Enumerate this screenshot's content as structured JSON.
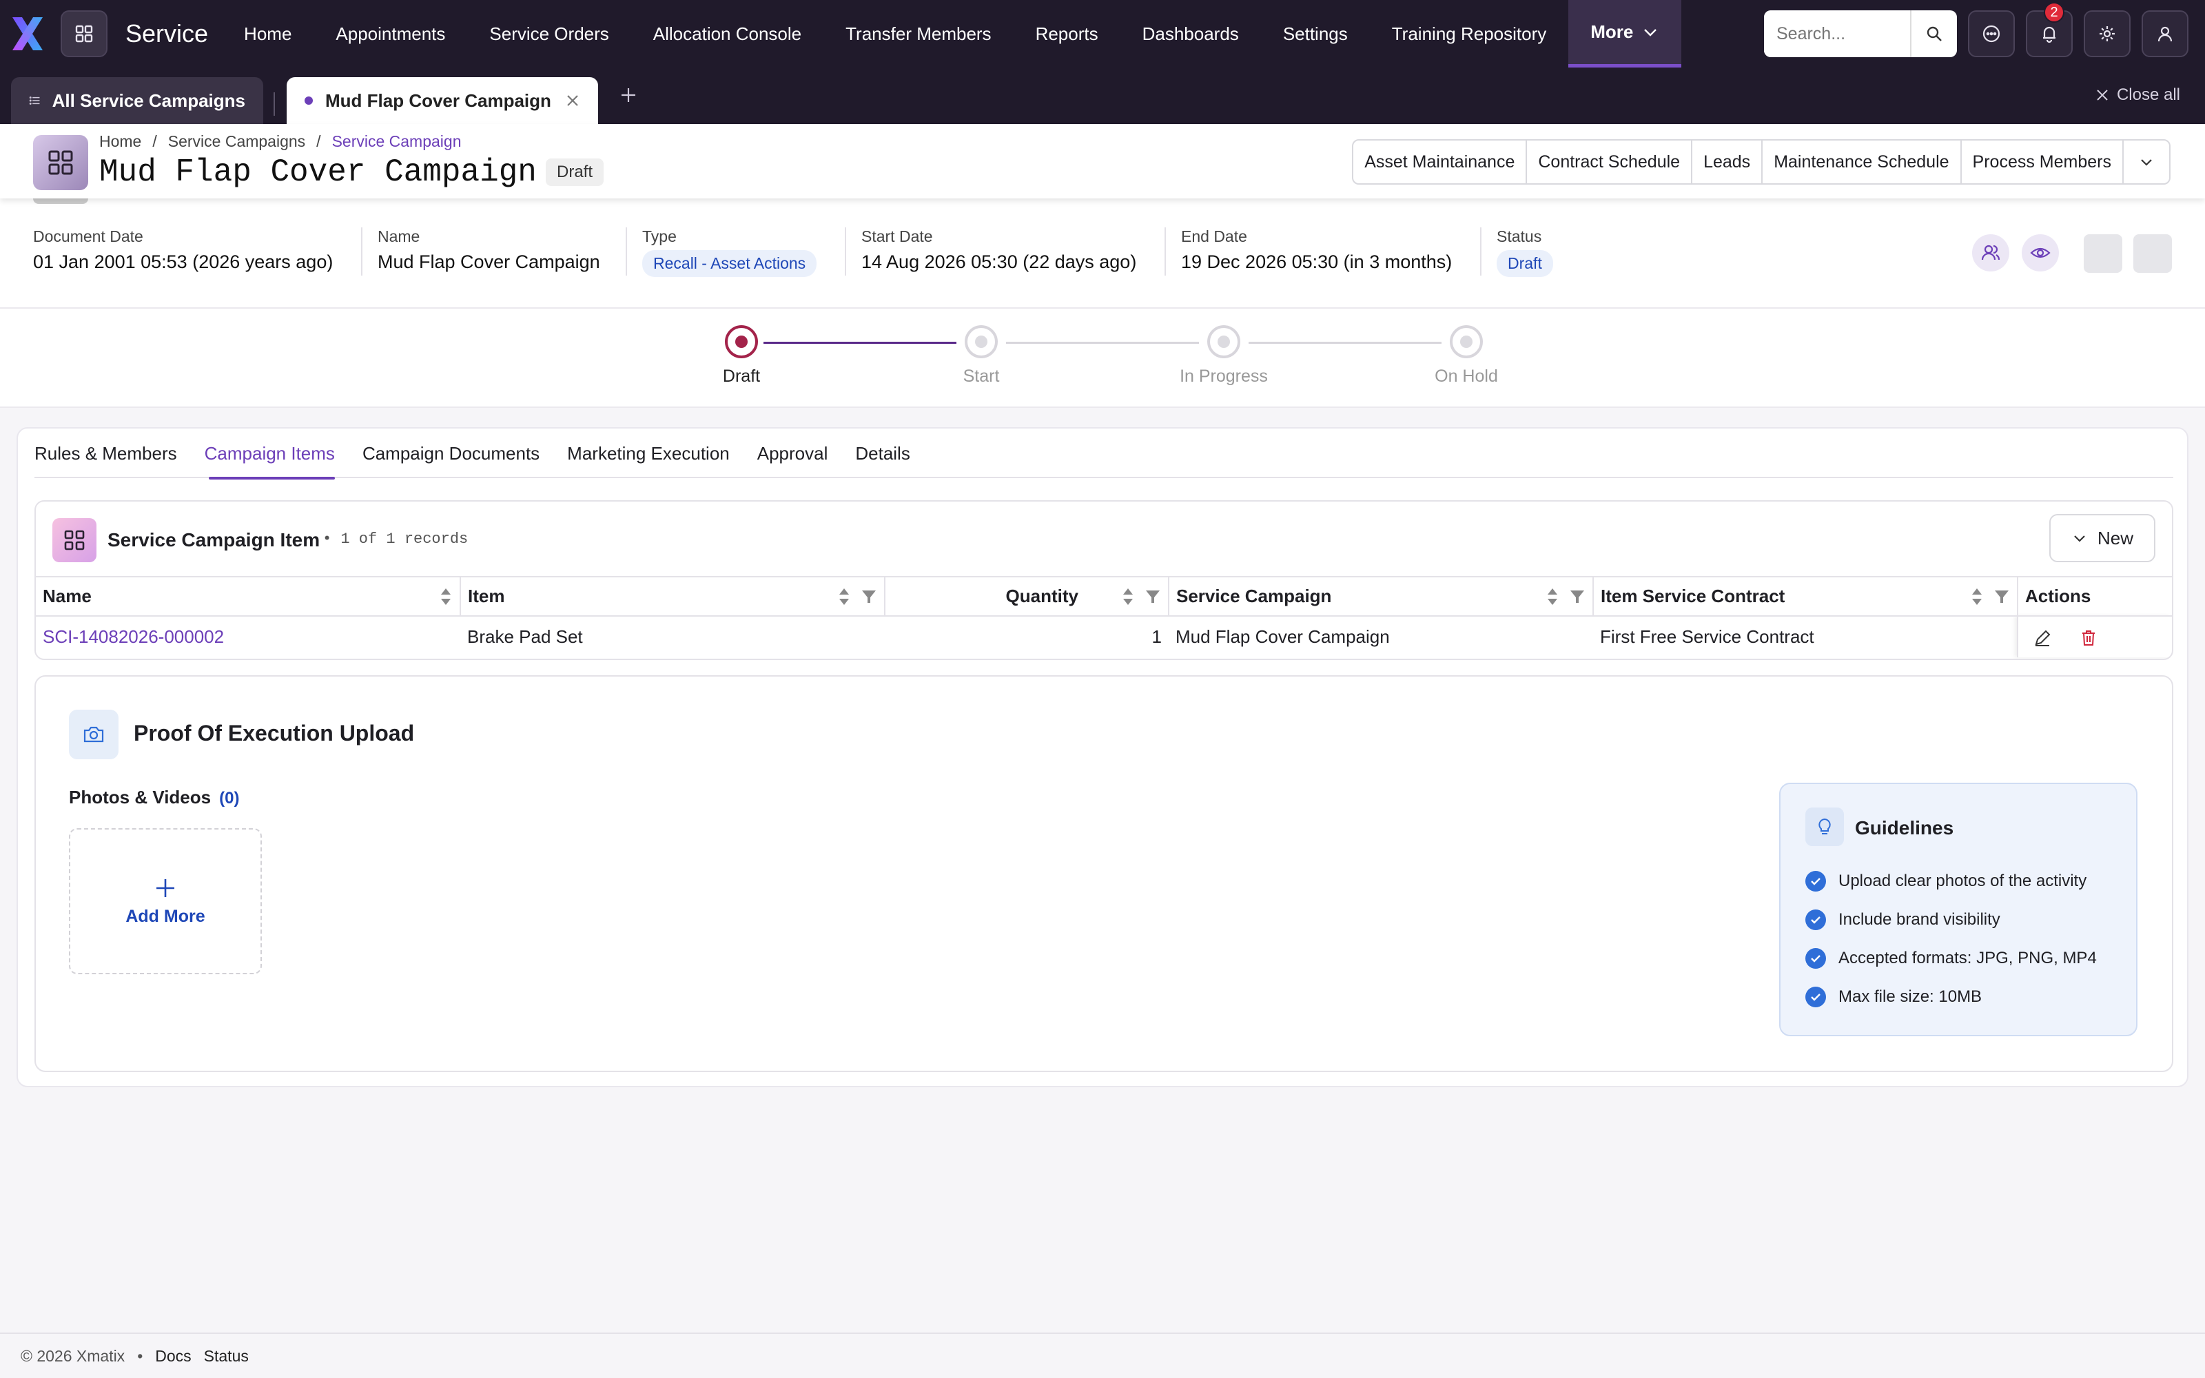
{
  "nav": {
    "brand": "Service",
    "items": [
      "Home",
      "Appointments",
      "Service Orders",
      "Allocation Console",
      "Transfer Members",
      "Reports",
      "Dashboards",
      "Settings",
      "Training Repository"
    ],
    "more_label": "More",
    "search_placeholder": "Search...",
    "notification_count": "2"
  },
  "tabs": {
    "all_label": "All Service Campaigns",
    "active_label": "Mud Flap Cover Campaign",
    "close_all": "Close all"
  },
  "header": {
    "breadcrumb": [
      "Home",
      "/",
      "Service Campaigns",
      "/",
      "Service Campaign"
    ],
    "title": "Mud Flap Cover Campaign",
    "status_chip": "Draft",
    "actions": [
      "Asset Maintainance",
      "Contract Schedule",
      "Leads",
      "Maintenance Schedule",
      "Process Members"
    ]
  },
  "info": {
    "document_date_label": "Document Date",
    "document_date": "01 Jan 2001 05:53 (2026 years ago)",
    "name_label": "Name",
    "name": "Mud Flap Cover Campaign",
    "type_label": "Type",
    "type": "Recall - Asset Actions",
    "start_label": "Start Date",
    "start": "14 Aug 2026 05:30 (22 days ago)",
    "end_label": "End Date",
    "end": "19 Dec 2026 05:30 (in 3 months)",
    "status_label": "Status",
    "status": "Draft"
  },
  "progress": {
    "steps": [
      "Draft",
      "Start",
      "In Progress",
      "On Hold"
    ],
    "current": 0
  },
  "content_tabs": [
    "Rules & Members",
    "Campaign Items",
    "Campaign Documents",
    "Marketing Execution",
    "Approval",
    "Details"
  ],
  "grid": {
    "title": "Service Campaign Item",
    "count": "• 1 of 1 records",
    "new_label": "New",
    "columns": [
      "Name",
      "Item",
      "Quantity",
      "Service Campaign",
      "Item Service Contract",
      "Actions"
    ],
    "rows": [
      {
        "name": "SCI-14082026-000002",
        "item": "Brake Pad Set",
        "quantity": "1",
        "campaign": "Mud Flap Cover Campaign",
        "contract": "First Free Service Contract"
      }
    ]
  },
  "proof": {
    "title": "Proof Of Execution Upload",
    "photos_label": "Photos & Videos",
    "photos_count": "(0)",
    "add_more": "Add More",
    "guidelines_title": "Guidelines",
    "guidelines": [
      "Upload clear photos of the activity",
      "Include brand visibility",
      "Accepted formats: JPG, PNG, MP4",
      "Max file size: 10MB"
    ]
  },
  "footer": {
    "copyright": "© 2026 Xmatix",
    "sep": "•",
    "links": [
      "Docs",
      "Status"
    ]
  },
  "colors": {
    "nav_bg": "#201a2b",
    "accent": "#6c3fb8",
    "step_active": "#a3234a",
    "link_blue": "#1e47b7"
  }
}
